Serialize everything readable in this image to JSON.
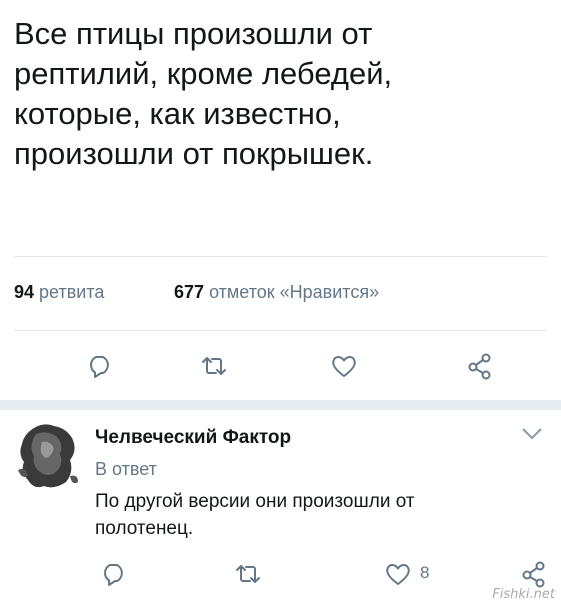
{
  "tweet": {
    "text_lines": [
      "Все птицы произошли от",
      "рептилий, кроме лебедей,",
      "которые, как известно,",
      "произошли от покрышек."
    ],
    "retweets_count": "94",
    "retweets_label": "ретвита",
    "likes_count": "677",
    "likes_label": "отметок «Нравится»",
    "actions": [
      "reply-icon",
      "retweet-icon",
      "like-icon",
      "share-icon"
    ]
  },
  "reply": {
    "author_name": "Челвеческий Фактор",
    "reply_to": "В ответ",
    "text_lines": [
      "По другой версии они произошли от",
      "полотенец."
    ],
    "like_count": "8",
    "actions": [
      "reply-icon",
      "retweet-icon",
      "like-icon",
      "share-icon"
    ]
  },
  "watermark": "Fishki.net",
  "colors": {
    "text": "#14171a",
    "secondary": "#657786",
    "divider": "#e1e8ed",
    "thread_separator": "#e6ecf0"
  }
}
